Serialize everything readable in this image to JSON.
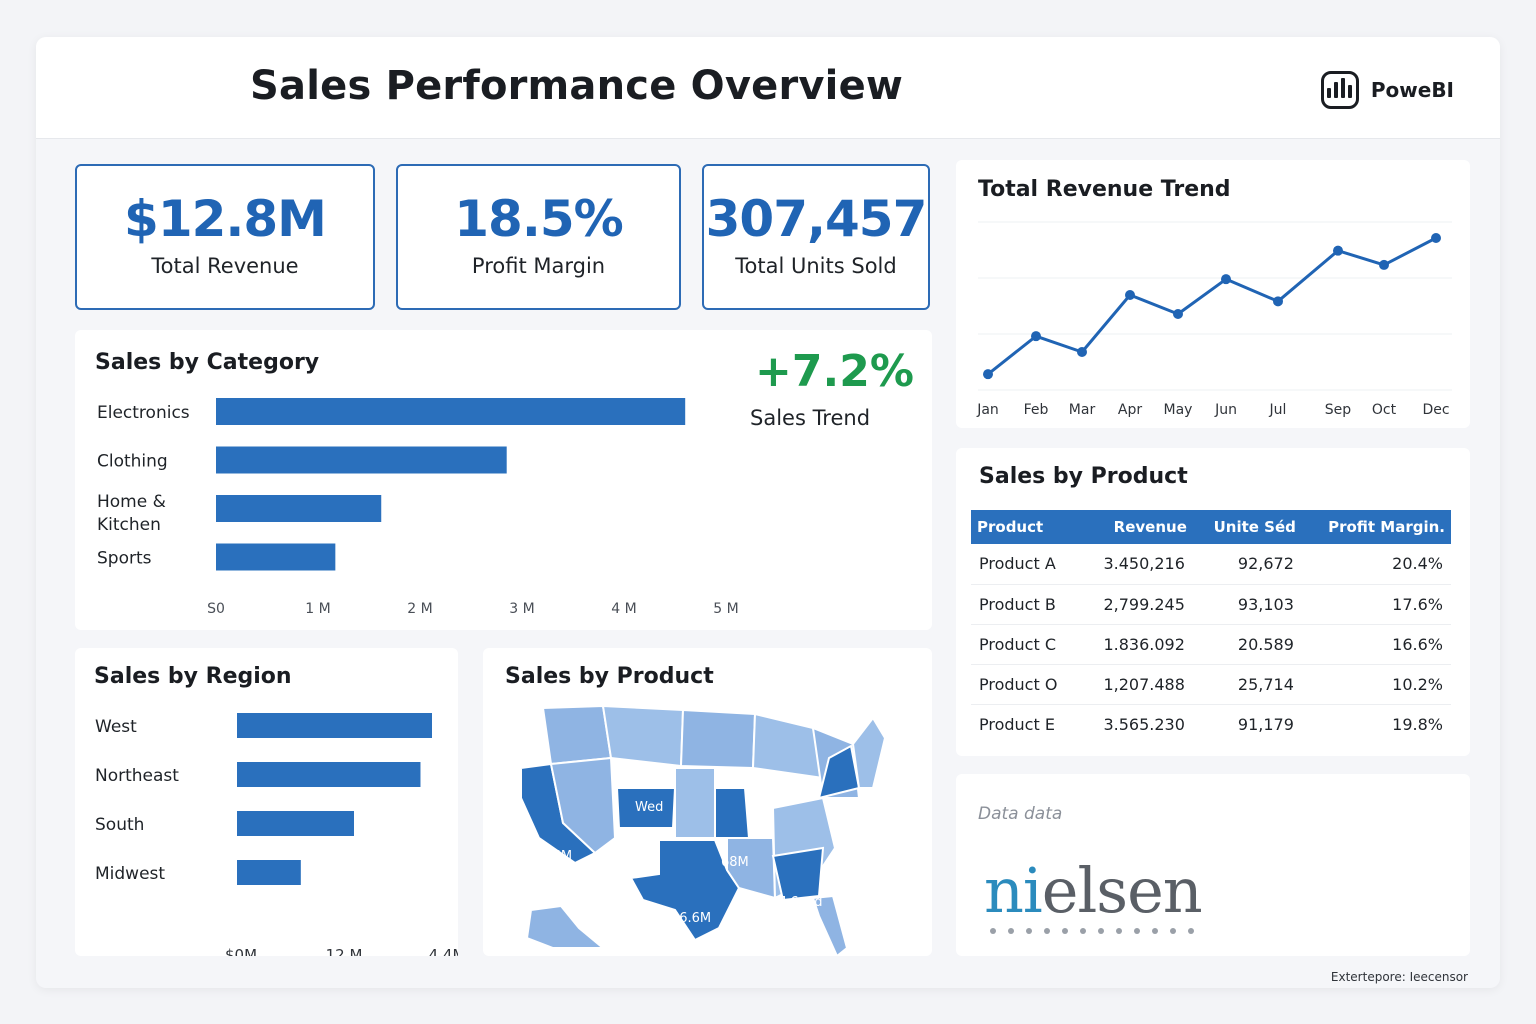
{
  "header": {
    "title": "Sales Performance Overview",
    "brand": "PoweBI",
    "brand_icon": "bar-chart-icon"
  },
  "kpis": [
    {
      "value": "$12.8M",
      "label": "Total Revenue"
    },
    {
      "value": "18.5%",
      "label": "Profit Margin"
    },
    {
      "value": "307,457",
      "label": "Total Units Sold"
    }
  ],
  "category_chart": {
    "title": "Sales by Category",
    "trend_value": "+7.2%",
    "trend_label": "Sales Trend",
    "colors": {
      "bar": "#2a70bd",
      "trend": "#1e9a4e"
    },
    "chart_data": {
      "type": "bar",
      "orientation": "horizontal",
      "categories": [
        "Electronics",
        "Clothing",
        "Home & Kitchen",
        "Sports"
      ],
      "values": [
        4.6,
        2.85,
        1.62,
        1.17
      ],
      "xlim": [
        0,
        5
      ],
      "ticks": [
        0,
        1,
        2,
        3,
        4,
        5
      ],
      "tick_labels": [
        "S0",
        "1 M",
        "2 M",
        "3 M",
        "4 M",
        "5 M"
      ]
    }
  },
  "revenue_trend": {
    "title": "Total Revenue Trend",
    "color": "#2064b4",
    "chart_data": {
      "type": "line",
      "x": [
        "Jan",
        "Feb",
        "Mar",
        "Apr",
        "May",
        "Jun",
        "Jul",
        "Sep",
        "Oct",
        "Dec"
      ],
      "y": [
        0.5,
        1.7,
        1.2,
        3.0,
        2.4,
        3.5,
        2.8,
        4.4,
        3.95,
        4.8
      ],
      "ylim": [
        0,
        6
      ],
      "grid": true
    }
  },
  "region_chart": {
    "title": "Sales by Region",
    "color": "#2a70bd",
    "chart_data": {
      "type": "bar",
      "orientation": "horizontal",
      "categories": [
        "West",
        "Northeast",
        "South",
        "Midwest"
      ],
      "values": [
        4.55,
        3.45,
        2.2,
        1.2
      ],
      "xlim": [
        0,
        4.4
      ],
      "tick_labels": [
        "$0M",
        "12 M",
        "4.4M"
      ]
    }
  },
  "map_card": {
    "title": "Sales by Product",
    "labels": [
      "S3.6M",
      "Wed",
      "68M",
      "S6.6M",
      "M 6ovd"
    ],
    "colors": {
      "light": "#8fb4e3",
      "dark": "#2a70bd",
      "border": "#ffffff"
    }
  },
  "product_table": {
    "title": "Sales by Product",
    "headers": [
      "Product",
      "Revenue",
      "Unite Séd",
      "Profit Margin."
    ],
    "rows": [
      [
        "Product A",
        "3.450,216",
        "92,672",
        "20.4%"
      ],
      [
        "Product B",
        "2,799.245",
        "93,103",
        "17.6%"
      ],
      [
        "Product C",
        "1.836.092",
        "20.589",
        "16.6%"
      ],
      [
        "Product O",
        "1,207.488",
        "25,714",
        "10.2%"
      ],
      [
        "Product E",
        "3.565.230",
        "91,179",
        "19.8%"
      ]
    ]
  },
  "data_source": {
    "label": "Data data",
    "logo": "nielsen",
    "logo_icon": "nielsen-logo"
  },
  "footer": {
    "note": "Extertepore: Ieecensor"
  }
}
